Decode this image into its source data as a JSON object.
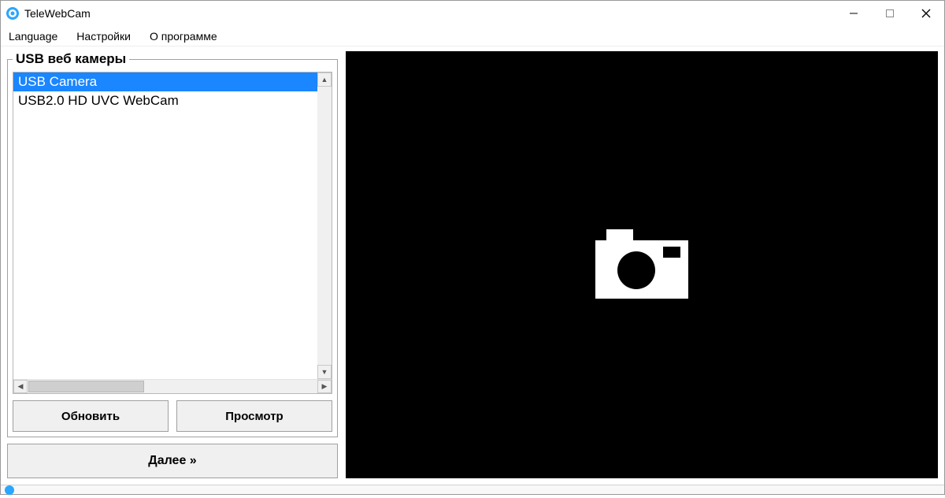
{
  "window": {
    "title": "TeleWebCam"
  },
  "menu": {
    "language": "Language",
    "settings": "Настройки",
    "about": "О программе"
  },
  "cameras": {
    "group_label": "USB веб камеры",
    "items": [
      {
        "label": "USB Camera",
        "selected": true
      },
      {
        "label": "USB2.0 HD UVC WebCam",
        "selected": false
      }
    ]
  },
  "buttons": {
    "refresh": "Обновить",
    "preview": "Просмотр",
    "next": "Далее »"
  }
}
